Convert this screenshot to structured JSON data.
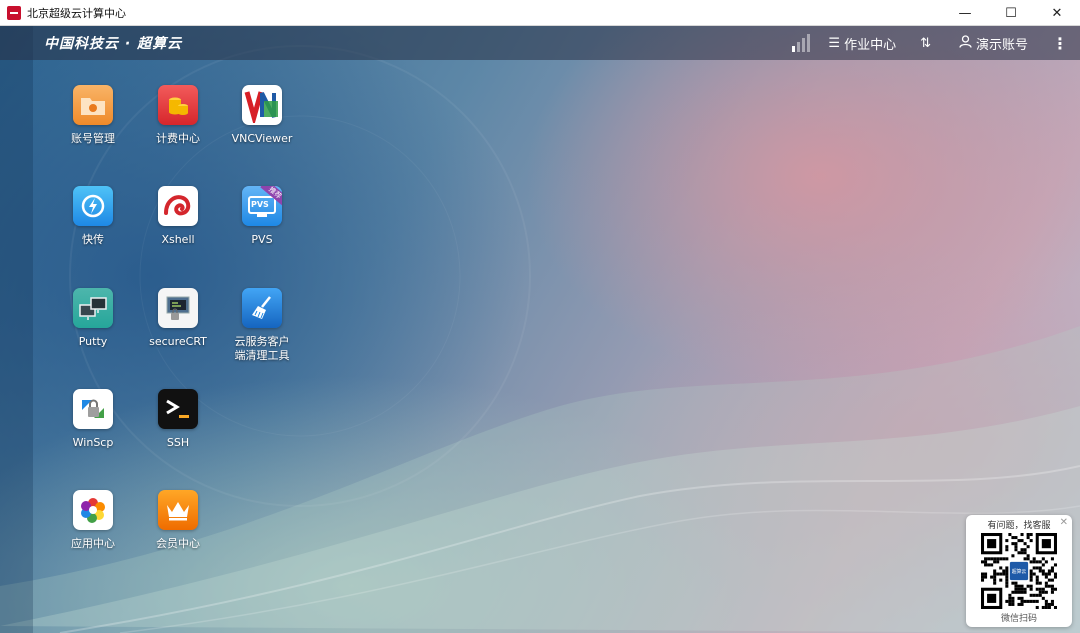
{
  "window": {
    "title": "北京超级云计算中心",
    "minimize_glyph": "—",
    "maximize_glyph": "☐",
    "close_glyph": "✕"
  },
  "topbar": {
    "brand": "中国科技云 · 超算云",
    "jobs_label": "作业中心",
    "account_label": "演示账号"
  },
  "desktop": {
    "apps": [
      {
        "id": "account",
        "label": "账号管理"
      },
      {
        "id": "billing",
        "label": "计费中心"
      },
      {
        "id": "vnc",
        "label": "VNCViewer"
      },
      {
        "id": "quick",
        "label": "快传"
      },
      {
        "id": "xshell",
        "label": "Xshell"
      },
      {
        "id": "pvs",
        "label": "PVS",
        "badge": "推荐",
        "inner": "PVS"
      },
      {
        "id": "putty",
        "label": "Putty"
      },
      {
        "id": "securecrt",
        "label": "secureCRT"
      },
      {
        "id": "cleaner",
        "label": "云服务客户端清理工具"
      },
      {
        "id": "winscp",
        "label": "WinScp"
      },
      {
        "id": "ssh",
        "label": "SSH"
      },
      {
        "id": "appcenter",
        "label": "应用中心"
      },
      {
        "id": "member",
        "label": "会员中心"
      }
    ]
  },
  "support": {
    "title": "有问题，找客服",
    "center_text": "超算云",
    "footer": "微信扫码"
  },
  "colors": {
    "accent_red": "#c8102e",
    "topbar_bg": "rgba(40,50,70,0.55)"
  }
}
